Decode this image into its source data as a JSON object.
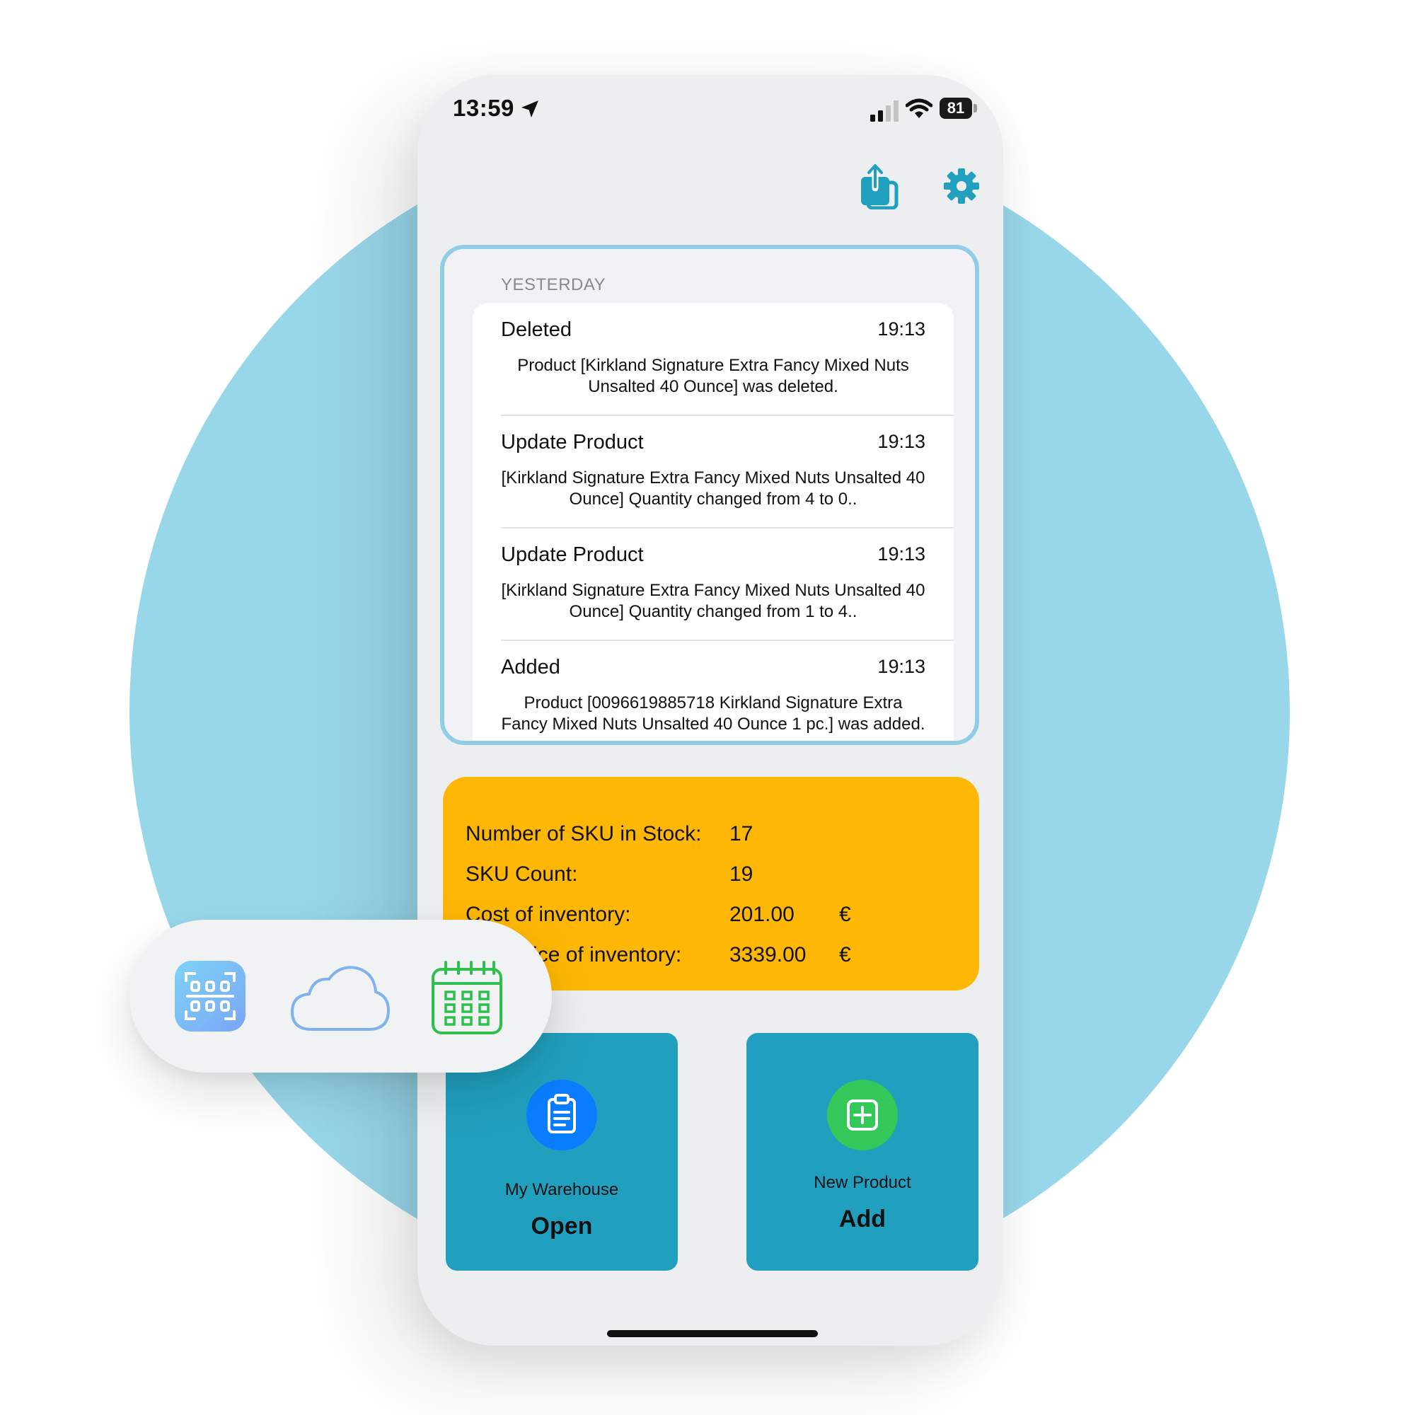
{
  "status_bar": {
    "time": "13:59",
    "battery": "81"
  },
  "toolbar": {
    "share_icon": "share-icon",
    "settings_icon": "gear-icon",
    "accent": "#219fbe"
  },
  "log": {
    "section": "YESTERDAY",
    "entries": [
      {
        "title": "Deleted",
        "time": "19:13",
        "description": "Product [Kirkland Signature Extra Fancy Mixed Nuts Unsalted 40 Ounce] was deleted."
      },
      {
        "title": "Update Product",
        "time": "19:13",
        "description": "[Kirkland Signature Extra Fancy Mixed Nuts Unsalted 40 Ounce] Quantity changed from 4 to 0.."
      },
      {
        "title": "Update Product",
        "time": "19:13",
        "description": "[Kirkland Signature Extra Fancy Mixed Nuts Unsalted 40 Ounce] Quantity changed from 1 to 4.."
      },
      {
        "title": "Added",
        "time": "19:13",
        "description": "Product [0096619885718 Kirkland Signature Extra Fancy Mixed Nuts Unsalted 40 Ounce 1 pc.] was added."
      }
    ]
  },
  "stats": {
    "background": "#fdb704",
    "rows": [
      {
        "label": "Number of SKU in Stock:",
        "value": "17",
        "currency": ""
      },
      {
        "label": "SKU Count:",
        "value": "19",
        "currency": ""
      },
      {
        "label": "Cost of inventory:",
        "value": "201.00",
        "currency": "€"
      },
      {
        "label": "Sale price of inventory:",
        "value": "3339.00",
        "currency": "€"
      }
    ]
  },
  "tiles": {
    "warehouse": {
      "label": "My Warehouse",
      "action": "Open",
      "icon": "clipboard-icon",
      "icon_color": "#0a7cff"
    },
    "new_product": {
      "label": "New Product",
      "action": "Add",
      "icon": "plus-square-icon",
      "icon_color": "#34c759"
    }
  },
  "dock": {
    "icons": [
      "barcode-scanner-icon",
      "cloud-icon",
      "calendar-icon"
    ]
  }
}
